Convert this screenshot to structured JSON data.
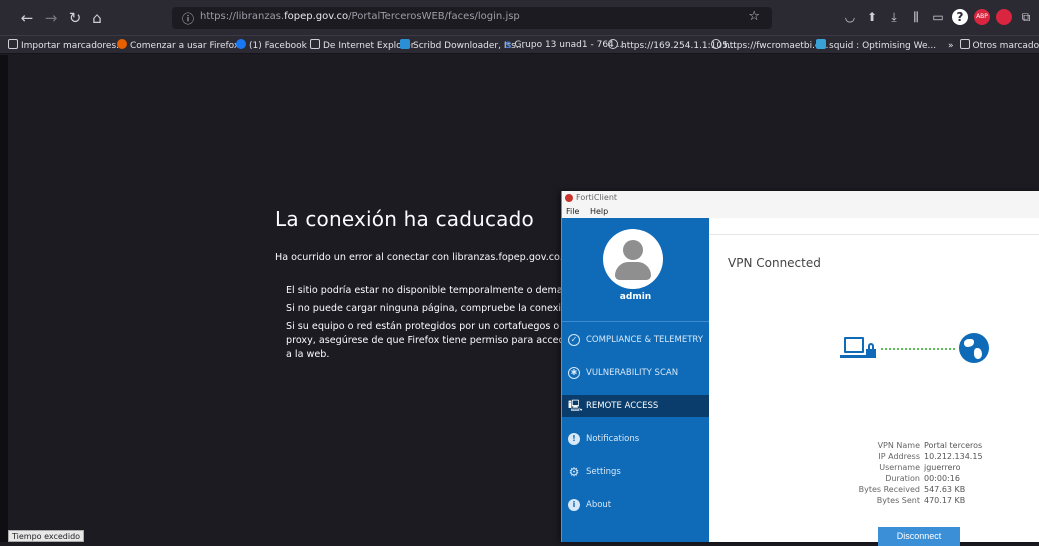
{
  "browser": {
    "url_prefix": "https://libranzas.",
    "url_domain": "fopep.gov.co",
    "url_path": "/PortalTercerosWEB/faces/login.jsp",
    "bookmarks": [
      {
        "label": "Importar marcadores...",
        "color": "#cfcfd8"
      },
      {
        "label": "Comenzar a usar Firefox",
        "color": "#e66000"
      },
      {
        "label": "(1) Facebook",
        "color": "#1877f2"
      },
      {
        "label": "De Internet Explorer",
        "color": "#cfcfd8"
      },
      {
        "label": "Scribd Downloader, Iss...",
        "color": "#2a8fd4"
      },
      {
        "label": "Grupo 13 unad1 - 764 ...",
        "color": "#4a7bd4"
      },
      {
        "label": "https://169.254.1.1:105...",
        "color": "#cfcfd8"
      },
      {
        "label": "https://fwcromaetbi.c...",
        "color": "#cfcfd8"
      },
      {
        "label": "squid : Optimising We...",
        "color": "#3aa0d8"
      }
    ],
    "more_bookmarks": "Otros marcadores",
    "status_tip": "Tiempo excedido"
  },
  "error": {
    "title": "La conexión ha caducado",
    "description": "Ha ocurrido un error al conectar con libranzas.fopep.gov.co.",
    "bullets": [
      "El sitio podría estar no disponible temporalmente o demasiado ocupado.",
      "Si no puede cargar ninguna página, compruebe la conexión de red.",
      "Si su equipo o red están protegidos por un cortafuegos o proxy, asegúrese de que Firefox tiene permiso para acceder a la web."
    ]
  },
  "forticlient": {
    "title": "FortiClient",
    "menu": [
      "File",
      "Help"
    ],
    "user": "admin",
    "nav": [
      {
        "label": "COMPLIANCE & TELEMETRY",
        "icon": "compliance-icon",
        "active": false
      },
      {
        "label": "VULNERABILITY SCAN",
        "icon": "vulnerability-icon",
        "active": false
      },
      {
        "label": "REMOTE ACCESS",
        "icon": "remote-access-icon",
        "active": true
      },
      {
        "label": "Notifications",
        "icon": "notifications-icon",
        "active": false
      },
      {
        "label": "Settings",
        "icon": "settings-icon",
        "active": false
      },
      {
        "label": "About",
        "icon": "about-icon",
        "active": false
      }
    ],
    "status": "VPN Connected",
    "details": [
      {
        "label": "VPN Name",
        "value": "Portal terceros"
      },
      {
        "label": "IP Address",
        "value": "10.212.134.15"
      },
      {
        "label": "Username",
        "value": "jguerrero"
      },
      {
        "label": "Duration",
        "value": "00:00:16"
      },
      {
        "label": "Bytes Received",
        "value": "547.63 KB"
      },
      {
        "label": "Bytes Sent",
        "value": "470.17 KB"
      }
    ],
    "disconnect_label": "Disconnect",
    "accent_color": "#0f6bb8"
  }
}
